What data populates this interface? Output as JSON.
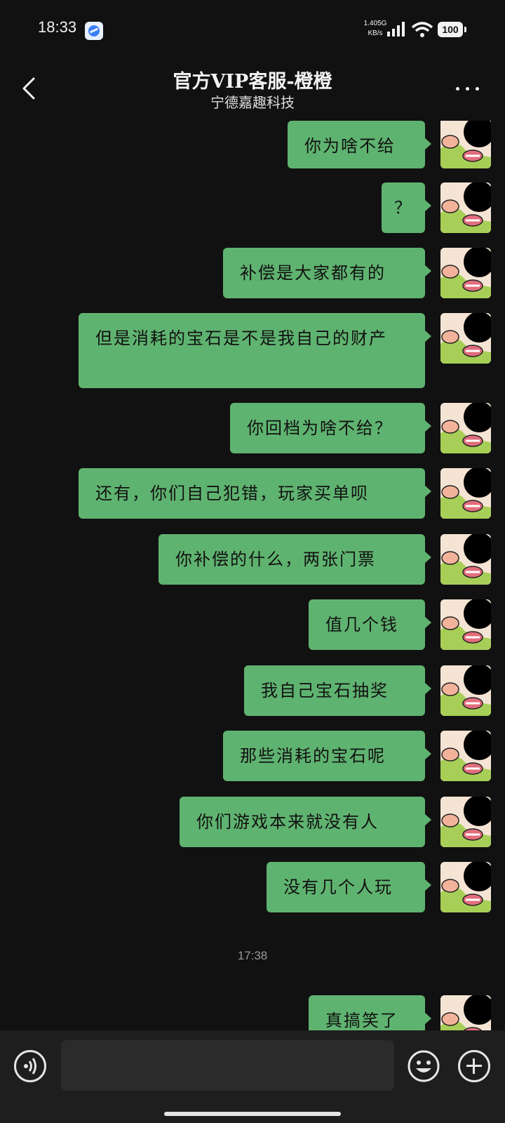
{
  "status_bar": {
    "time": "18:33",
    "net_speed_value": "1.40",
    "net_speed_unit": "KB/s",
    "network_type": "5G",
    "battery": "100",
    "icons": [
      "app-browser-icon",
      "signal-icon",
      "wifi-icon",
      "battery-icon"
    ]
  },
  "header": {
    "title": "官方VIP客服-橙橙",
    "subtitle": "宁德嘉趣科技",
    "back_icon": "chevron-left-icon",
    "more_icon": "more-dots-icon"
  },
  "messages": [
    {
      "text": "你为啥不给"
    },
    {
      "text": "？"
    },
    {
      "text": "补偿是大家都有的"
    },
    {
      "text": "但是消耗的宝石是不是我自己的财产"
    },
    {
      "text": "你回档为啥不给？"
    },
    {
      "text": "还有，你们自己犯错，玩家买单呗"
    },
    {
      "text": "你补偿的什么，两张门票"
    },
    {
      "text": "值几个钱"
    },
    {
      "text": "我自己宝石抽奖"
    },
    {
      "text": "那些消耗的宝石呢"
    },
    {
      "text": "你们游戏本来就没有人"
    },
    {
      "text": "没有几个人玩"
    },
    {
      "timestamp": "17:38"
    },
    {
      "text": "真搞笑了"
    }
  ],
  "input_bar": {
    "placeholder": "",
    "voice_icon": "voice-icon",
    "emoji_icon": "emoji-icon",
    "plus_icon": "plus-icon"
  },
  "colors": {
    "background": "#111111",
    "bubble": "#5fb370",
    "bottom_bar": "#1e1e1e"
  }
}
